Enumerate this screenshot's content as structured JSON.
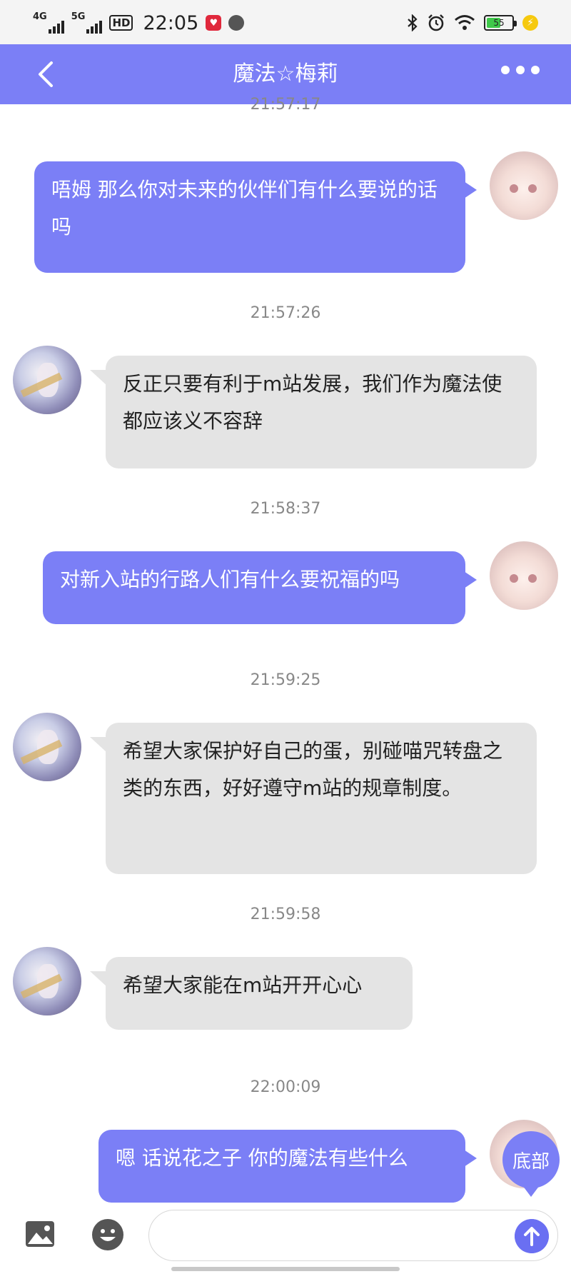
{
  "status_bar": {
    "net1": "4G",
    "net2": "5G",
    "hd": "HD",
    "time": "22:05",
    "battery": "55"
  },
  "header": {
    "title": "魔法☆梅莉"
  },
  "messages": [
    {
      "time": "21:57:17",
      "from": "me",
      "text": "唔姆 那么你对未来的伙伴们有什么要说的话吗"
    },
    {
      "time": "21:57:26",
      "from": "other",
      "text": "反正只要有利于m站发展，我们作为魔法使都应该义不容辞"
    },
    {
      "time": "21:58:37",
      "from": "me",
      "text": "对新入站的行路人们有什么要祝福的吗"
    },
    {
      "time": "21:59:25",
      "from": "other",
      "text": "希望大家保护好自己的蛋，别碰喵咒转盘之类的东西，好好遵守m站的规章制度。"
    },
    {
      "time": "21:59:58",
      "from": "other",
      "text": "希望大家能在m站开开心心"
    },
    {
      "time": "22:00:09",
      "from": "me",
      "text": "嗯 话说花之子 你的魔法有些什么"
    }
  ],
  "scroll_bottom_label": "底部",
  "colors": {
    "accent": "#7b7ff6",
    "other_bubble": "#e4e4e4",
    "timestamp": "#888888"
  }
}
